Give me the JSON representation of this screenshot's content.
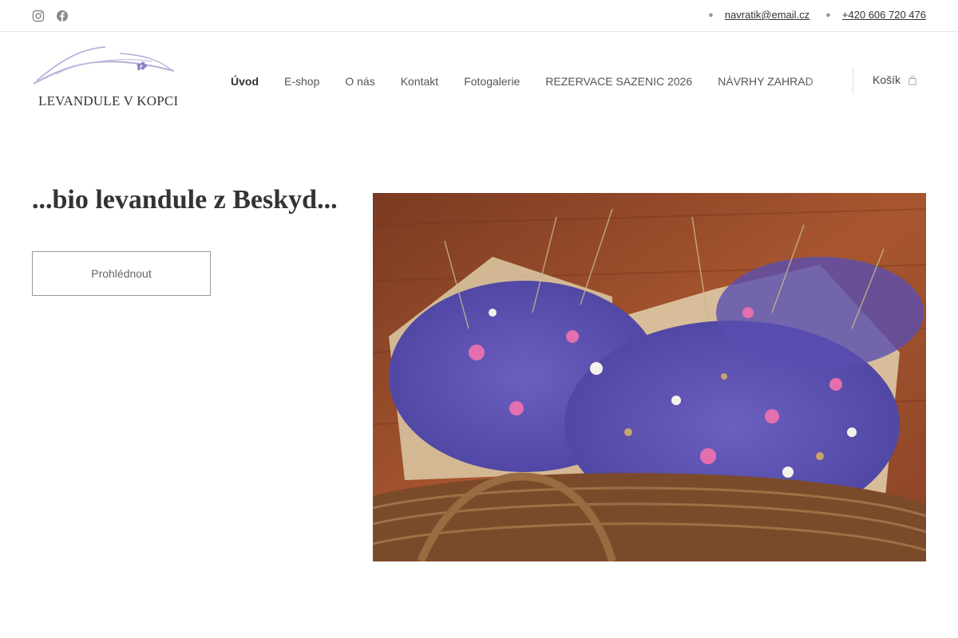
{
  "topbar": {
    "email": "navratik@email.cz",
    "phone": "+420 606 720 476",
    "social": [
      "instagram-icon",
      "facebook-icon"
    ]
  },
  "brand": {
    "name": "LEVANDULE V KOPCI",
    "accent": "#9b8fc6"
  },
  "nav": {
    "items": [
      {
        "label": "Úvod",
        "active": true
      },
      {
        "label": "E-shop"
      },
      {
        "label": "O nás"
      },
      {
        "label": "Kontakt"
      },
      {
        "label": "Fotogalerie"
      },
      {
        "label": "REZERVACE SAZENIC 2026"
      },
      {
        "label": "NÁVRHY ZAHRAD"
      }
    ],
    "cart_label": "Košík"
  },
  "hero": {
    "title": "...bio levandule z Beskyd...",
    "button_label": "Prohlédnout"
  }
}
